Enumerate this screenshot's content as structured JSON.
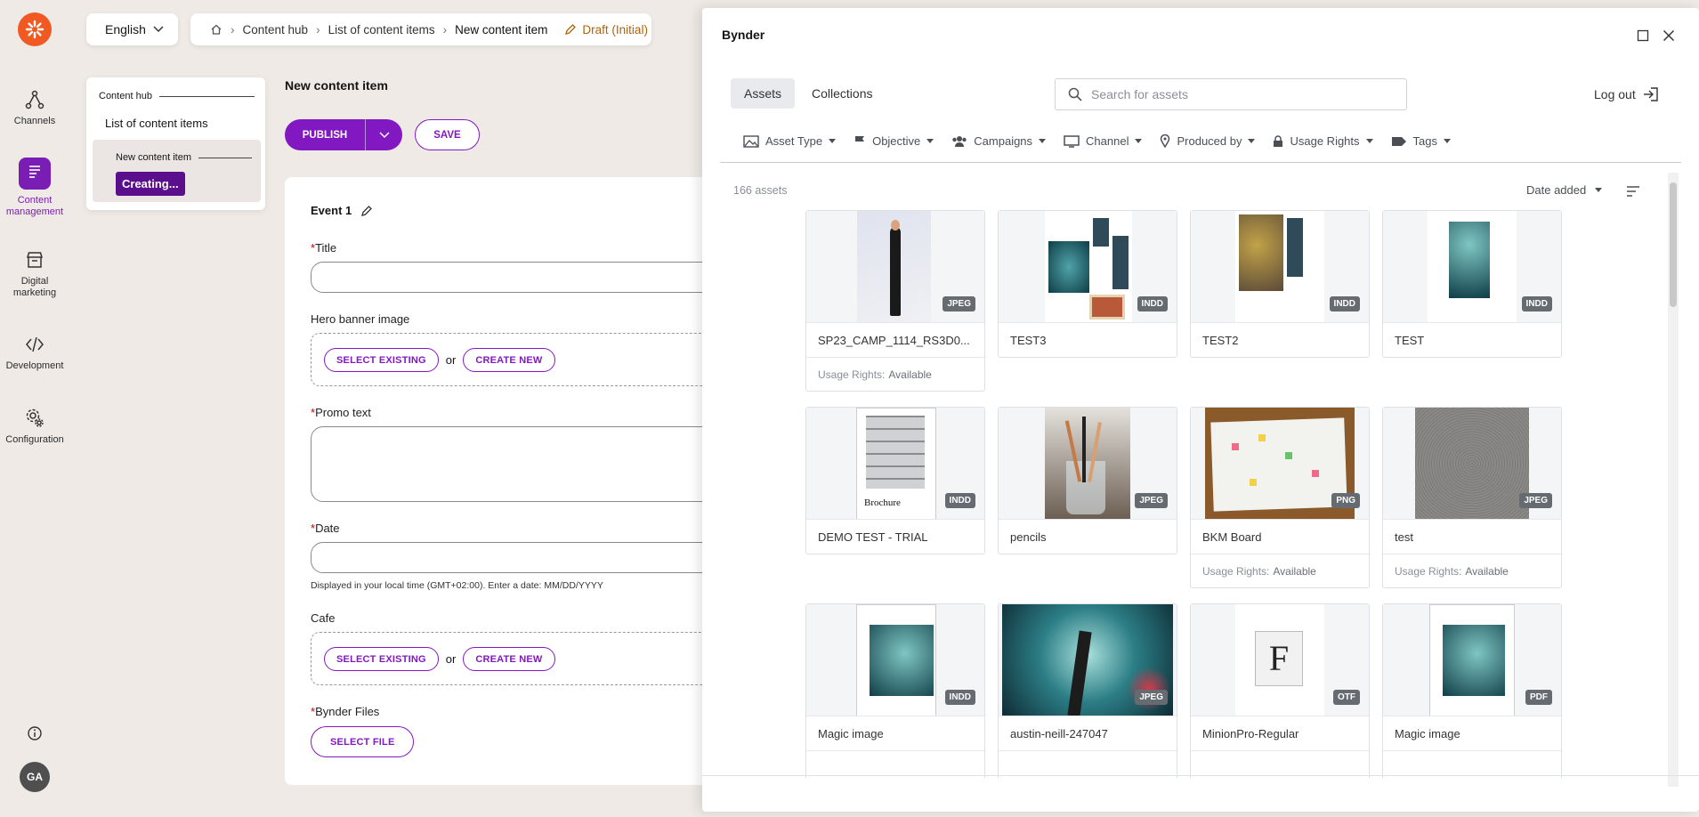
{
  "app": {
    "brand_color": "#f05a22",
    "accent": "#8218c2"
  },
  "rail": {
    "items": [
      {
        "label": "Channels",
        "icon": "channels-icon"
      },
      {
        "label": "Content management",
        "icon": "content-management-icon"
      },
      {
        "label": "Digital marketing",
        "icon": "digital-marketing-icon"
      },
      {
        "label": "Development",
        "icon": "development-icon"
      },
      {
        "label": "Configuration",
        "icon": "configuration-icon"
      }
    ],
    "avatar": "GA"
  },
  "language": {
    "value": "English"
  },
  "breadcrumb": {
    "items": [
      "Content hub",
      "List of content items",
      "New content item"
    ],
    "status": "Draft (Initial)"
  },
  "navigator": {
    "root": "Content hub",
    "list": "List of content items",
    "current": "New content item",
    "state": "Creating..."
  },
  "main": {
    "title": "New content item",
    "publish_label": "PUBLISH",
    "save_label": "SAVE",
    "section_title": "Event 1",
    "fields": {
      "title_label": "Title",
      "hero_label": "Hero banner image",
      "select_existing": "SELECT EXISTING",
      "or": "or",
      "create_new": "CREATE NEW",
      "promo_label": "Promo text",
      "date_label": "Date",
      "date_hint": "Displayed in your local time (GMT+02:00). Enter a date: MM/DD/YYYY",
      "cafe_label": "Cafe",
      "bynder_label": "Bynder Files",
      "select_file": "SELECT FILE",
      "required_mark": "*"
    }
  },
  "modal": {
    "title": "Bynder",
    "tabs": [
      "Assets",
      "Collections"
    ],
    "search_placeholder": "Search for assets",
    "logout": "Log out",
    "filters": [
      "Asset Type",
      "Objective",
      "Campaigns",
      "Channel",
      "Produced by",
      "Usage Rights",
      "Tags"
    ],
    "count": "166 assets",
    "sort": "Date added",
    "usage_label": "Usage Rights:",
    "assets": [
      {
        "name": "SP23_CAMP_1114_RS3D0...",
        "type": "JPEG",
        "rights": "Available"
      },
      {
        "name": "TEST3",
        "type": "INDD",
        "rights": ""
      },
      {
        "name": "TEST2",
        "type": "INDD",
        "rights": ""
      },
      {
        "name": "TEST",
        "type": "INDD",
        "rights": ""
      },
      {
        "name": "DEMO TEST - TRIAL",
        "type": "INDD",
        "rights": ""
      },
      {
        "name": "pencils",
        "type": "JPEG",
        "rights": ""
      },
      {
        "name": "BKM Board",
        "type": "PNG",
        "rights": "Available"
      },
      {
        "name": "test",
        "type": "JPEG",
        "rights": "Available"
      },
      {
        "name": "Magic image",
        "type": "INDD",
        "rights": ""
      },
      {
        "name": "austin-neill-247047",
        "type": "JPEG",
        "rights": ""
      },
      {
        "name": "MinionPro-Regular",
        "type": "OTF",
        "rights": ""
      },
      {
        "name": "Magic image",
        "type": "PDF",
        "rights": ""
      }
    ]
  }
}
